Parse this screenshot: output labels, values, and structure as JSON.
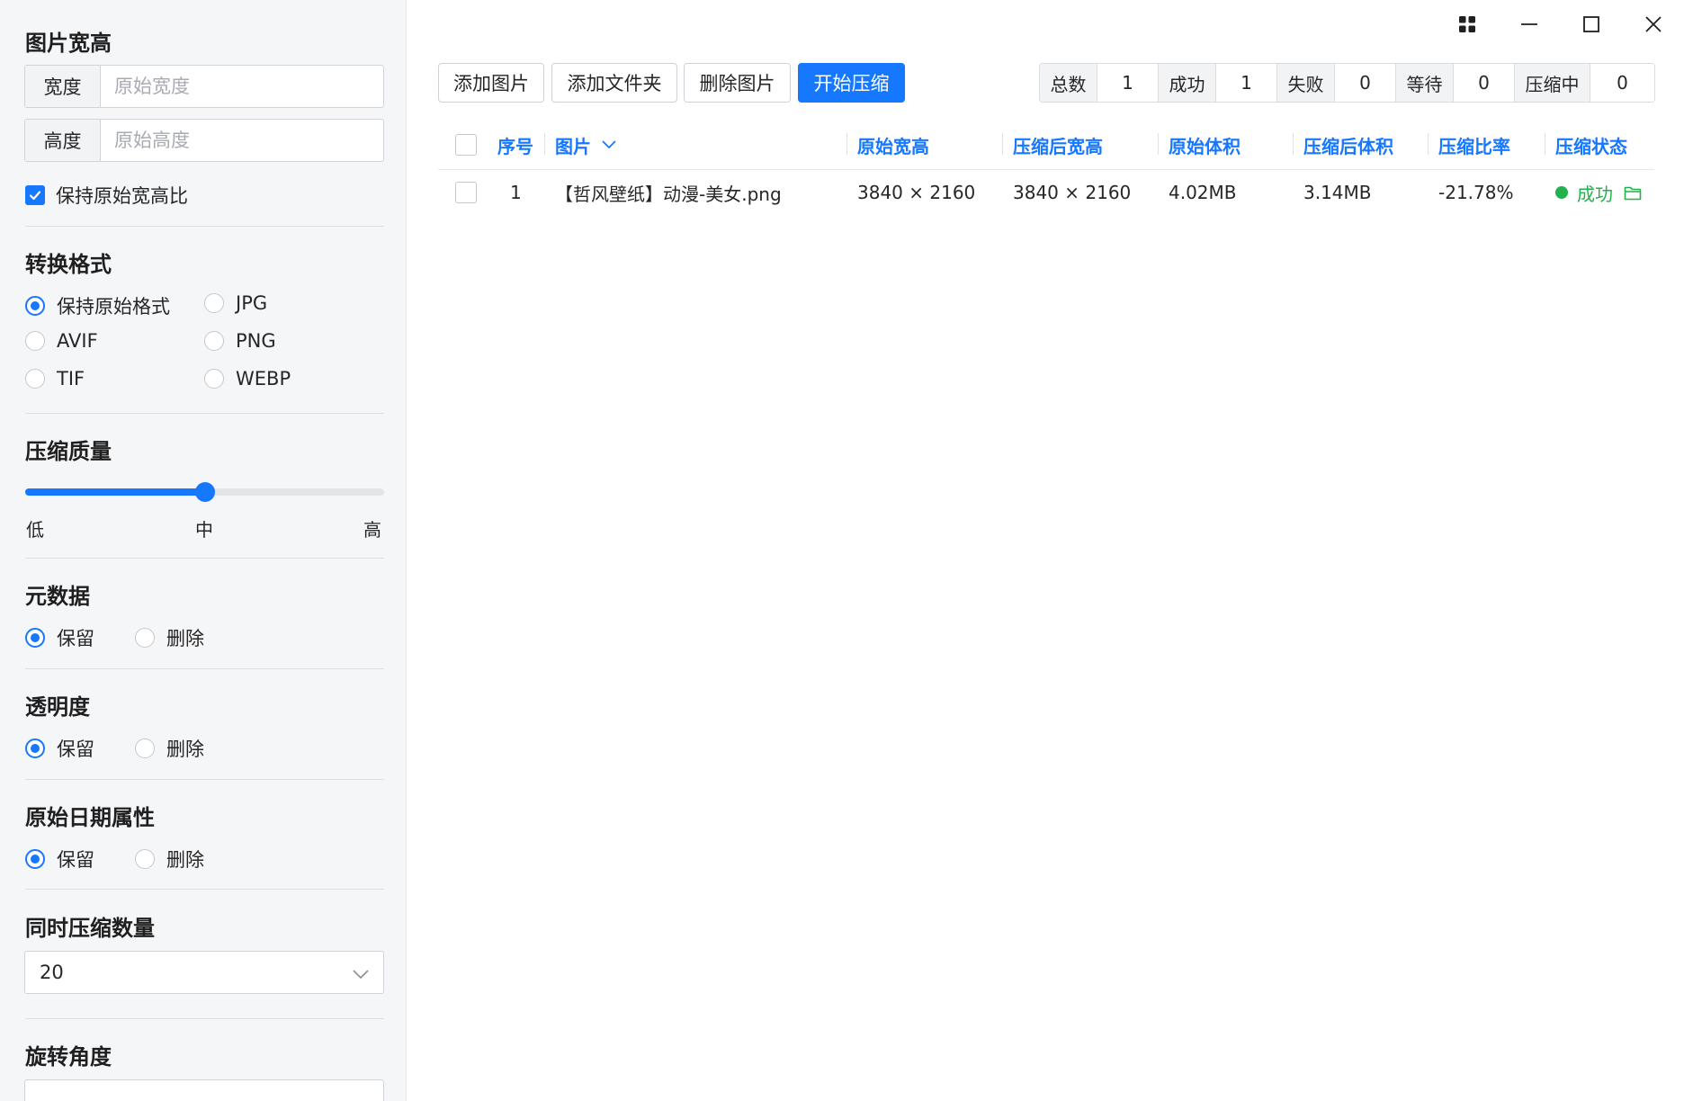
{
  "sidebar": {
    "size": {
      "title": "图片宽高",
      "width_prefix": "宽度",
      "width_placeholder": "原始宽度",
      "width_value": "",
      "height_prefix": "高度",
      "height_placeholder": "原始高度",
      "height_value": "",
      "keep_ratio_label": "保持原始宽高比",
      "keep_ratio_checked": true
    },
    "format": {
      "title": "转换格式",
      "options": [
        "保持原始格式",
        "JPG",
        "AVIF",
        "PNG",
        "TIF",
        "WEBP"
      ],
      "selected": "保持原始格式"
    },
    "quality": {
      "title": "压缩质量",
      "low_label": "低",
      "mid_label": "中",
      "high_label": "高",
      "value": 0.5
    },
    "metadata": {
      "title": "元数据",
      "keep_label": "保留",
      "delete_label": "删除",
      "selected": "保留"
    },
    "transparency": {
      "title": "透明度",
      "keep_label": "保留",
      "delete_label": "删除",
      "selected": "保留"
    },
    "date_attr": {
      "title": "原始日期属性",
      "keep_label": "保留",
      "delete_label": "删除",
      "selected": "保留"
    },
    "concurrency": {
      "title": "同时压缩数量",
      "value": "20"
    },
    "rotation": {
      "title": "旋转角度"
    }
  },
  "toolbar": {
    "add_image": "添加图片",
    "add_folder": "添加文件夹",
    "delete_image": "删除图片",
    "start_compress": "开始压缩"
  },
  "stats": {
    "total_label": "总数",
    "total": "1",
    "success_label": "成功",
    "success": "1",
    "failed_label": "失败",
    "failed": "0",
    "waiting_label": "等待",
    "waiting": "0",
    "compressing_label": "压缩中",
    "compressing": "0"
  },
  "table": {
    "headers": {
      "index": "序号",
      "image": "图片",
      "orig_size": "原始宽高",
      "new_size": "压缩后宽高",
      "orig_volume": "原始体积",
      "new_volume": "压缩后体积",
      "ratio": "压缩比率",
      "status": "压缩状态"
    },
    "rows": [
      {
        "index": "1",
        "name": "【哲风壁纸】动漫-美女.png",
        "orig_size": "3840 × 2160",
        "new_size": "3840 × 2160",
        "orig_volume": "4.02MB",
        "new_volume": "3.14MB",
        "ratio": "-21.78%",
        "status": "成功"
      }
    ]
  },
  "colors": {
    "accent": "#1677ff",
    "success": "#22b14c",
    "sidebar_bg": "#f5f6f8"
  },
  "icons": {
    "window": [
      "grid-icon",
      "minimize-icon",
      "maximize-icon",
      "close-icon"
    ],
    "row_status": "folder-icon",
    "select": "chevron-down-icon",
    "header_image": "chevron-down-icon"
  }
}
